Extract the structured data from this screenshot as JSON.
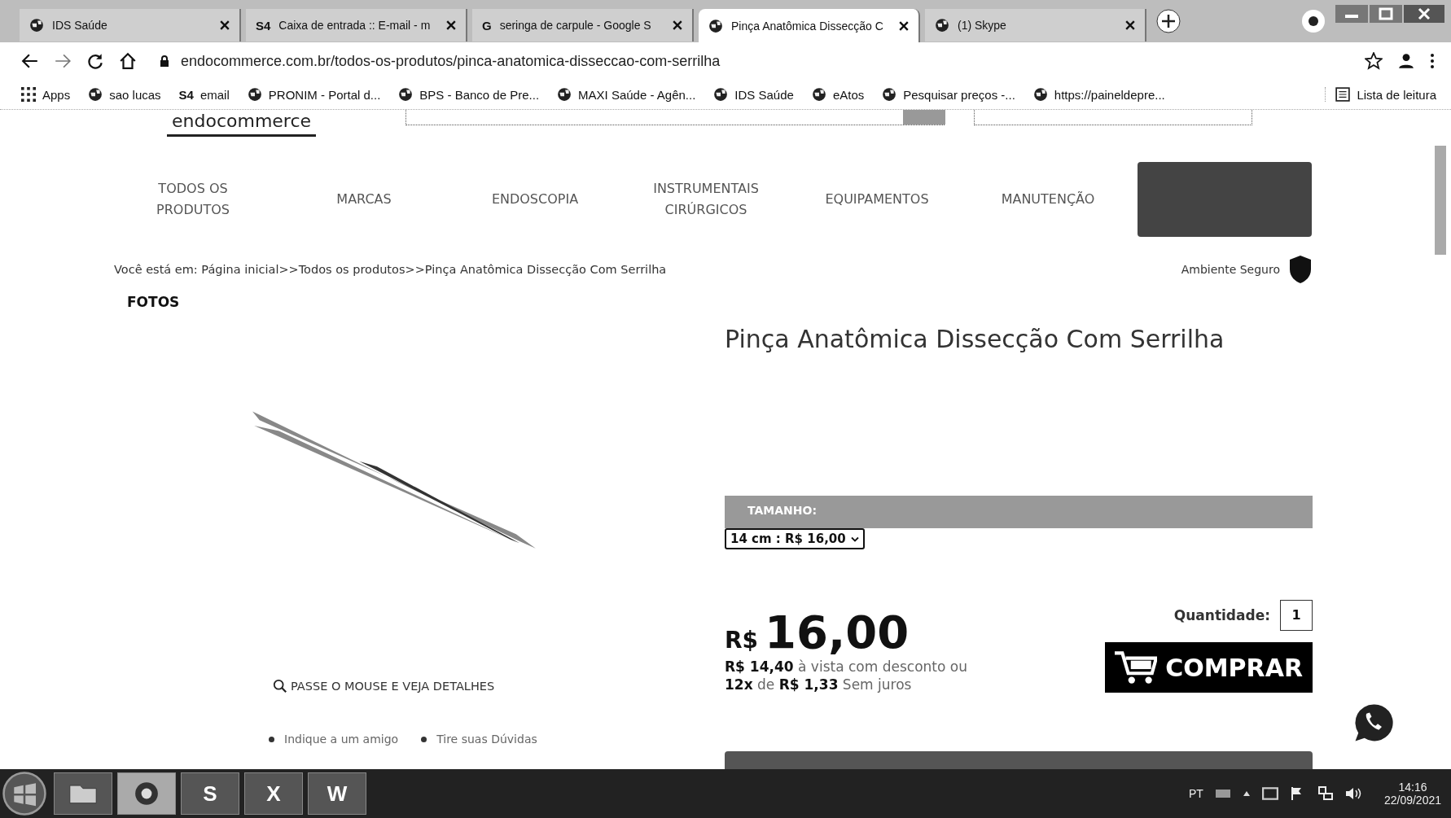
{
  "browser": {
    "tabs": [
      {
        "title": "IDS Saúde",
        "selected": false
      },
      {
        "title": "Caixa de entrada :: E-mail - m",
        "selected": false,
        "glyph": "S4"
      },
      {
        "title": "seringa de carpule - Google S",
        "selected": false,
        "glyph": "G"
      },
      {
        "title": "Pinça Anatômica Dissecção C",
        "selected": true
      },
      {
        "title": "(1) Skype",
        "selected": false
      }
    ],
    "url": "endocommerce.com.br/todos-os-produtos/pinca-anatomica-disseccao-com-serrilha",
    "bookmarks": [
      {
        "label": "Apps"
      },
      {
        "label": "sao lucas"
      },
      {
        "label": "email",
        "glyph": "S4"
      },
      {
        "label": "PRONIM - Portal d..."
      },
      {
        "label": "BPS - Banco de Pre..."
      },
      {
        "label": "MAXI Saúde - Agên..."
      },
      {
        "label": "IDS Saúde"
      },
      {
        "label": "eAtos"
      },
      {
        "label": "Pesquisar preços -..."
      },
      {
        "label": "https://paineldepre..."
      }
    ],
    "reading_list": "Lista de leitura"
  },
  "page": {
    "logo": "endocommerce",
    "nav": [
      "TODOS OS PRODUTOS",
      "MARCAS",
      "ENDOSCOPIA",
      "INSTRUMENTAIS CIRÚRGICOS",
      "EQUIPAMENTOS",
      "MANUTENÇÃO"
    ],
    "breadcrumb": "Você está em: Página inicial>>Todos os produtos>>Pinça Anatômica Dissecção Com Serrilha",
    "secure_label": "Ambiente Seguro",
    "photos_label": "FOTOS",
    "hover_hint": "PASSE O MOUSE E VEJA DETALHES",
    "links": [
      "Indique a um amigo",
      "Tire suas Dúvidas"
    ],
    "product": {
      "title": "Pinça Anatômica Dissecção Com Serrilha",
      "size_label": "TAMANHO:",
      "size_value": "14 cm : R$ 16,00",
      "currency": "R$",
      "price": "16,00",
      "cash_line": "**R$ 14,40** à vista com desconto ou",
      "installment_line": "**12x** de **R$ 1,33** Sem juros",
      "quantity_label": "Quantidade:",
      "quantity": "1",
      "buy": "COMPRAR"
    }
  },
  "taskbar": {
    "apps": [
      {
        "kind": "start"
      },
      {
        "kind": "folder"
      },
      {
        "kind": "chrome",
        "selected": true
      },
      {
        "kind": "letter",
        "glyph": "S",
        "selected": false
      },
      {
        "kind": "letter",
        "glyph": "X",
        "selected": false
      },
      {
        "kind": "letter",
        "glyph": "W",
        "selected": false
      }
    ],
    "language": "PT",
    "time": "14:16",
    "date": "22/09/2021"
  }
}
